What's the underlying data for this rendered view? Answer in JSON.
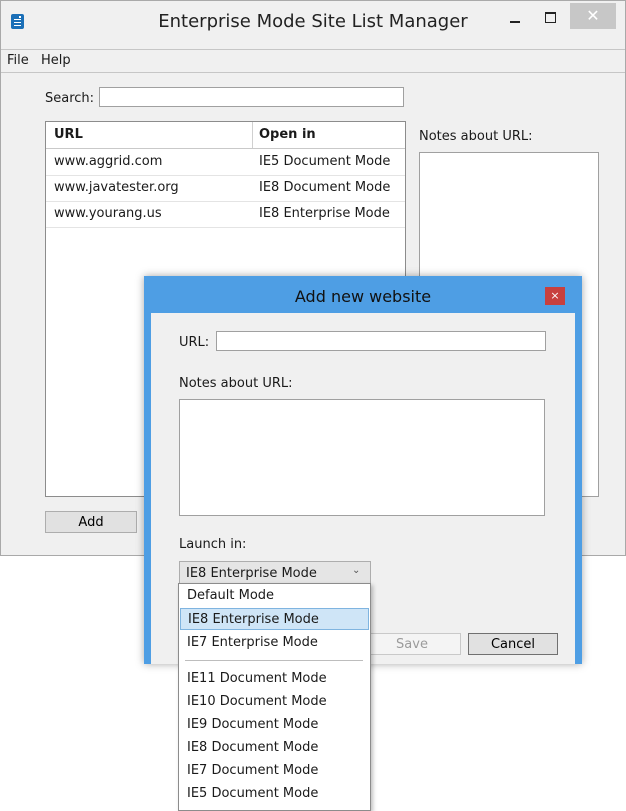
{
  "window": {
    "title": "Enterprise Mode Site List Manager",
    "close_glyph": "✕",
    "minimize_icon": "minimize-icon",
    "maximize_icon": "maximize-icon"
  },
  "menu": {
    "items": [
      "File",
      "Help"
    ]
  },
  "search": {
    "label": "Search:",
    "value": ""
  },
  "table": {
    "columns": [
      "URL",
      "Open in"
    ],
    "rows": [
      {
        "url": "www.aggrid.com",
        "mode": "IE5 Document Mode"
      },
      {
        "url": "www.javatester.org",
        "mode": "IE8 Document Mode"
      },
      {
        "url": "www.yourang.us",
        "mode": "IE8 Enterprise Mode"
      }
    ]
  },
  "notes": {
    "label": "Notes about URL:"
  },
  "add_button": "Add",
  "dialog": {
    "title": "Add new website",
    "close_glyph": "×",
    "url_label": "URL:",
    "url_value": "",
    "notes_label": "Notes about URL:",
    "launch_label": "Launch in:",
    "selected_value": "IE8 Enterprise Mode",
    "save_label": "Save",
    "cancel_label": "Cancel",
    "options": [
      "Default Mode",
      "IE8 Enterprise Mode",
      "IE7 Enterprise Mode",
      "IE11 Document Mode",
      "IE10 Document Mode",
      "IE9 Document Mode",
      "IE8 Document Mode",
      "IE7 Document Mode",
      "IE5 Document Mode"
    ]
  },
  "colors": {
    "dialog_frame": "#4e9ee4",
    "dialog_close": "#c8403e",
    "selected_option": "#cfe5f7"
  }
}
